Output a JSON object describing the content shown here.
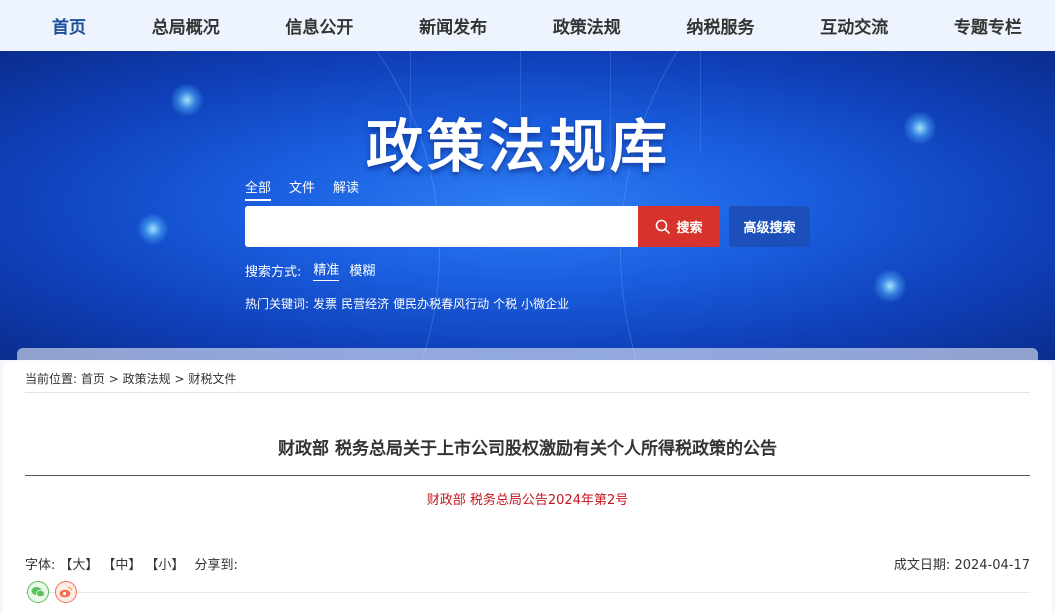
{
  "nav": {
    "items": [
      {
        "label": "首页",
        "active": true
      },
      {
        "label": "总局概况",
        "active": false
      },
      {
        "label": "信息公开",
        "active": false
      },
      {
        "label": "新闻发布",
        "active": false
      },
      {
        "label": "政策法规",
        "active": false
      },
      {
        "label": "纳税服务",
        "active": false
      },
      {
        "label": "互动交流",
        "active": false
      },
      {
        "label": "专题专栏",
        "active": false
      }
    ]
  },
  "banner": {
    "title": "政策法规库"
  },
  "search": {
    "tabs": [
      {
        "label": "全部",
        "active": true
      },
      {
        "label": "文件",
        "active": false
      },
      {
        "label": "解读",
        "active": false
      }
    ],
    "input_value": "",
    "search_label": "搜索",
    "advanced_label": "高级搜索",
    "mode_label": "搜索方式:",
    "modes": [
      {
        "label": "精准",
        "active": true
      },
      {
        "label": "模糊",
        "active": false
      }
    ],
    "hot_label": "热门关键词:",
    "hot_keywords": [
      "发票",
      "民营经济",
      "便民办税春风行动",
      "个税",
      "小微企业"
    ]
  },
  "breadcrumb": {
    "prefix": "当前位置:",
    "items": [
      "首页",
      "政策法规",
      "财税文件"
    ],
    "separator": ">"
  },
  "article": {
    "title": "财政部 税务总局关于上市公司股权激励有关个人所得税政策的公告",
    "doc_number": "财政部 税务总局公告2024年第2号",
    "font_label": "字体:",
    "font_sizes": [
      "【大】",
      "【中】",
      "【小】"
    ],
    "share_label": "分享到:",
    "date_label": "成文日期:",
    "date_value": "2024-04-17"
  },
  "share": {
    "icons": [
      "wechat-icon",
      "weibo-icon"
    ]
  },
  "colors": {
    "nav_bg": "#eef4fd",
    "nav_active": "#1d4f9f",
    "search_button": "#d8322c",
    "advanced_button": "#1c4fb9",
    "doc_number": "#c4161c"
  }
}
